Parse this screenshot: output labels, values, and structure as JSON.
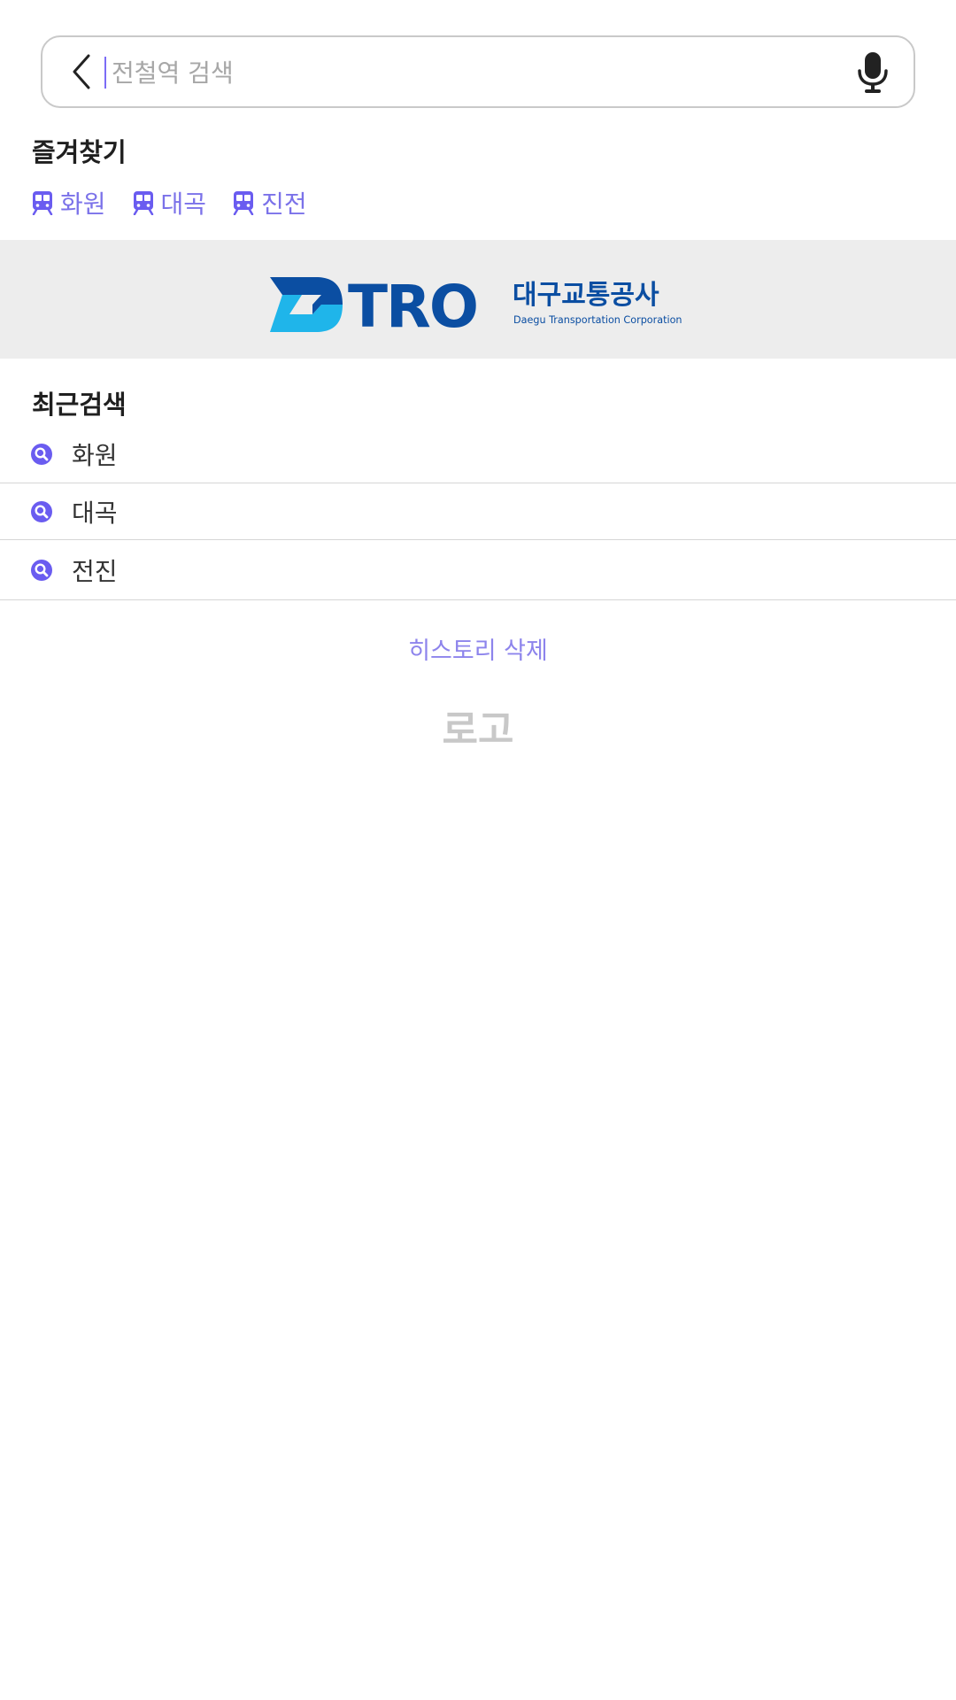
{
  "search": {
    "placeholder": "전철역 검색",
    "value": ""
  },
  "favorites": {
    "title": "즐겨찾기",
    "items": [
      {
        "label": "화원",
        "icon": "train-icon"
      },
      {
        "label": "대곡",
        "icon": "train-icon"
      },
      {
        "label": "진전",
        "icon": "train-icon"
      }
    ]
  },
  "banner": {
    "logo_text": "DTRO",
    "name_ko": "대구교통공사",
    "name_en": "Daegu Transportation Corporation",
    "colors": {
      "navy": "#0b4ea2",
      "cyan": "#1fb5ea",
      "background": "#ededed"
    }
  },
  "recent": {
    "title": "최근검색",
    "items": [
      {
        "label": "화원",
        "icon": "search-icon"
      },
      {
        "label": "대곡",
        "icon": "search-icon"
      },
      {
        "label": "전진",
        "icon": "search-icon"
      }
    ]
  },
  "actions": {
    "delete_history": "히스토리 삭제",
    "logo": "로고"
  },
  "theme": {
    "accent": "#7b72e9",
    "icon_purple": "#6a5cf0"
  }
}
